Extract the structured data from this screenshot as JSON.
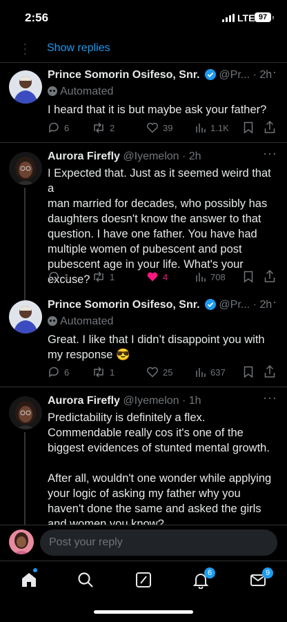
{
  "status_bar": {
    "time": "2:56",
    "network": "LTE",
    "battery": "97"
  },
  "thread": {
    "show_replies": "Show replies"
  },
  "tweets": [
    {
      "name": "Prince Somorin Osifeso, Snr.",
      "handle": "@Pr...",
      "sep": " · ",
      "time": "2h",
      "automated": "Automated",
      "lines": [
        "I heard that it is but maybe ask your father?"
      ],
      "replies": "6",
      "reposts": "2",
      "likes": "39",
      "views": "1.1K"
    },
    {
      "name": "Aurora Firefly",
      "handle": "@Iyemelon",
      "sep": " · ",
      "time": "2h",
      "lines": [
        "I Expected that. Just as it seemed weird that a",
        "man married for decades, who possibly has",
        "daughters doesn't know the answer to that",
        "question. I have one father. You have had",
        "multiple women of pubescent and post",
        "pubescent age in your life. What's your",
        "excuse?"
      ],
      "replies": "1",
      "reposts": "1",
      "likes": "4",
      "views": "708"
    },
    {
      "name": "Prince Somorin Osifeso, Snr.",
      "handle": "@Pr...",
      "sep": " · ",
      "time": "2h",
      "automated": "Automated",
      "lines": [
        "Great. I like that I didn’t disappoint you with",
        "my response 😎"
      ],
      "replies": "6",
      "reposts": "1",
      "likes": "25",
      "views": "637"
    },
    {
      "name": "Aurora Firefly",
      "handle": "@Iyemelon",
      "sep": " · ",
      "time": "1h",
      "lines": [
        "Predictability is definitely a flex.",
        "Commendable really cos it's one of the",
        "biggest evidences of stunted mental growth."
      ],
      "lines2": [
        "After all, wouldn't one wonder while applying",
        "your logic of asking my father why you",
        "haven't done the same and asked the girls",
        "and women you know?"
      ]
    }
  ],
  "composer": {
    "placeholder": "Post your reply"
  },
  "tabbar": {
    "notifications_count": "6",
    "messages_count": "9"
  },
  "colors": {
    "accent": "#1d9bf0",
    "like": "#f91880",
    "muted": "#71767b"
  }
}
